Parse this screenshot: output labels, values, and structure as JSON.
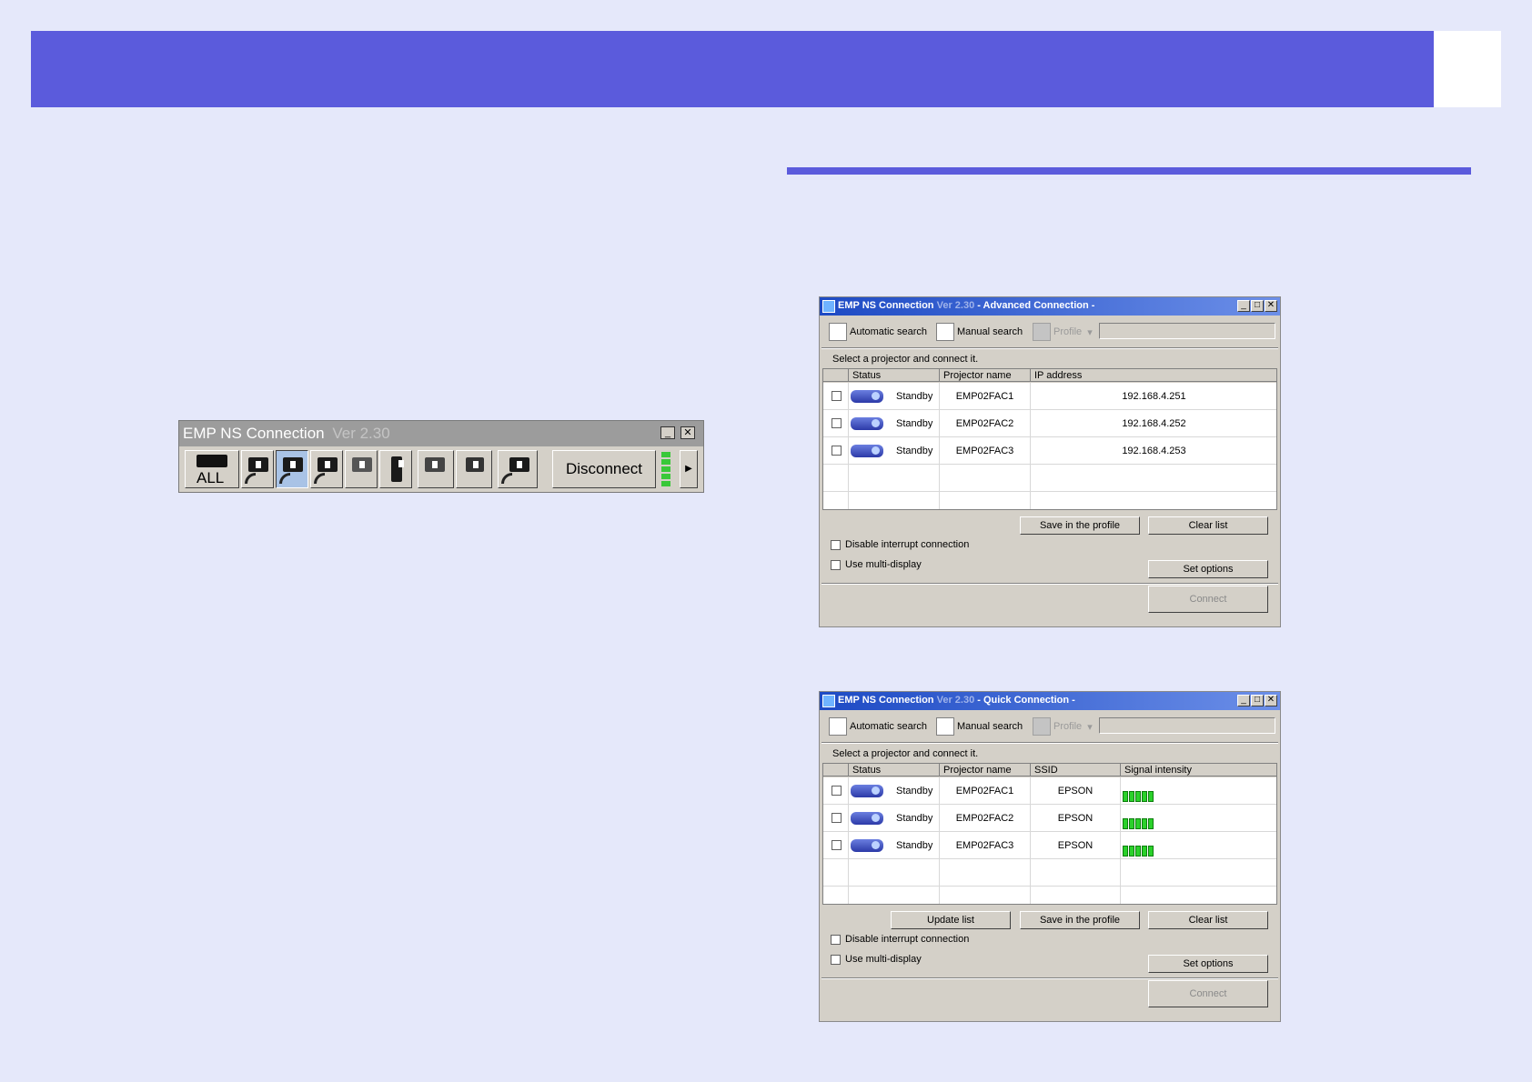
{
  "mini_toolbar": {
    "title": "EMP NS Connection",
    "version": "Ver 2.30",
    "all_label": "ALL",
    "disconnect_label": "Disconnect"
  },
  "advanced_window": {
    "title": "EMP NS Connection",
    "version": "Ver 2.30",
    "mode": "- Advanced Connection -",
    "toolbar": {
      "auto_search": "Automatic search",
      "manual_search": "Manual search",
      "profile": "Profile"
    },
    "instruction": "Select a projector and connect it.",
    "columns": [
      "Status",
      "Projector name",
      "IP address"
    ],
    "rows": [
      {
        "status": "Standby",
        "name": "EMP02FAC1",
        "ip": "192.168.4.251"
      },
      {
        "status": "Standby",
        "name": "EMP02FAC2",
        "ip": "192.168.4.252"
      },
      {
        "status": "Standby",
        "name": "EMP02FAC3",
        "ip": "192.168.4.253"
      }
    ],
    "save_profile": "Save in the profile",
    "clear_list": "Clear list",
    "disable_interrupt": "Disable interrupt connection",
    "multi_display": "Use multi-display",
    "set_options": "Set options",
    "connect": "Connect"
  },
  "quick_window": {
    "title": "EMP NS Connection",
    "version": "Ver 2.30",
    "mode": "- Quick Connection -",
    "toolbar": {
      "auto_search": "Automatic search",
      "manual_search": "Manual search",
      "profile": "Profile"
    },
    "instruction": "Select a projector and connect it.",
    "columns": [
      "Status",
      "Projector name",
      "SSID",
      "Signal intensity"
    ],
    "rows": [
      {
        "status": "Standby",
        "name": "EMP02FAC1",
        "ssid": "EPSON",
        "signal_bars": 5
      },
      {
        "status": "Standby",
        "name": "EMP02FAC2",
        "ssid": "EPSON",
        "signal_bars": 5
      },
      {
        "status": "Standby",
        "name": "EMP02FAC3",
        "ssid": "EPSON",
        "signal_bars": 5
      }
    ],
    "update_list": "Update list",
    "save_profile": "Save in the profile",
    "clear_list": "Clear list",
    "disable_interrupt": "Disable interrupt connection",
    "multi_display": "Use multi-display",
    "set_options": "Set options",
    "connect": "Connect"
  },
  "colors": {
    "accent": "#5b5bdc",
    "page_bg": "#e5e8fa",
    "signal_green": "#2ad12a"
  }
}
